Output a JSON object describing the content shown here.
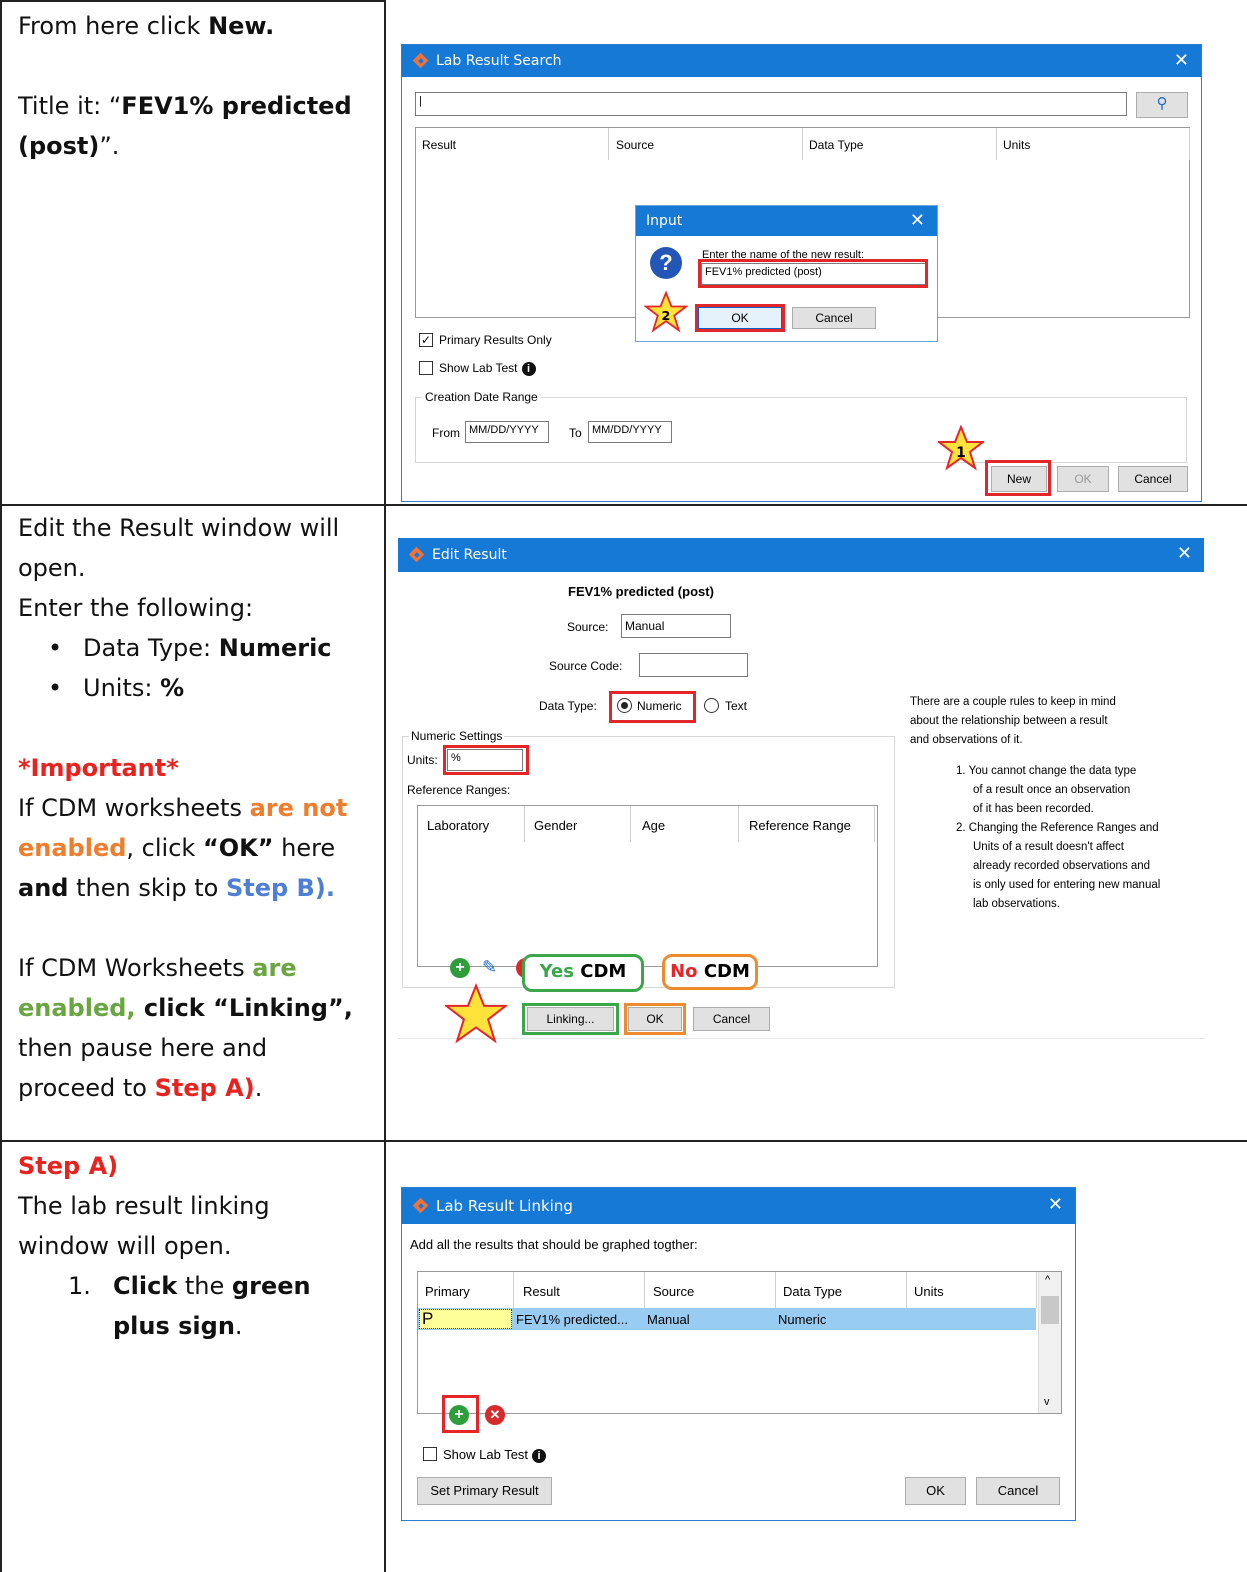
{
  "rows": [
    {
      "left": {
        "line1_prefix": "From here click ",
        "line1_bold": "New.",
        "line2_prefix": "Title it: “",
        "line2_bold_a": "FEV1% predicted",
        "line3_bold": "(post)",
        "line3_suffix": "”."
      },
      "dialog": {
        "title": "Lab Result Search",
        "columns": [
          "Result",
          "Source",
          "Data Type",
          "Units"
        ],
        "primary_only_label": "Primary Results Only",
        "primary_only_checked": true,
        "show_lab_test_label": "Show Lab Test",
        "date_range_label": "Creation Date Range",
        "from_label": "From",
        "to_label": "To",
        "date_placeholder": "MM/DD/YYYY",
        "buttons": {
          "new": "New",
          "ok": "OK",
          "cancel": "Cancel"
        },
        "input_dialog": {
          "title": "Input",
          "prompt": "Enter the name of the new result:",
          "value": "FEV1% predicted (post)",
          "ok": "OK",
          "cancel": "Cancel"
        },
        "star1": "1",
        "star2": "2"
      }
    },
    {
      "left": {
        "line1": "Edit the Result window will",
        "line2": "open.",
        "line3": "Enter the following:",
        "bullet1_prefix": "Data Type: ",
        "bullet1_bold": "Numeric",
        "bullet2_prefix": "Units: ",
        "bullet2_bold": "%",
        "important": "*Important*",
        "p1_a": "If CDM worksheets ",
        "p1_b": "are not",
        "p1_c": "enabled",
        "p1_d": ", click ",
        "p1_e": "“OK”",
        "p1_f": " here",
        "p1_g": "and",
        "p1_h": " then skip to ",
        "p1_i": "Step B",
        "p1_j": ").",
        "p2_a": "If CDM Worksheets ",
        "p2_b": "are",
        "p2_c": "enabled,",
        "p2_d": " click “Linking”,",
        "p2_e": "then pause here and",
        "p2_f": "proceed to ",
        "p2_g": "Step A",
        "p2_h": ")",
        "p2_i": "."
      },
      "dialog": {
        "title": "Edit Result",
        "result_name": "FEV1% predicted (post)",
        "source_label": "Source:",
        "source_value": "Manual",
        "source_code_label": "Source Code:",
        "data_type_label": "Data Type:",
        "numeric_label": "Numeric",
        "text_label": "Text",
        "numeric_settings_label": "Numeric Settings",
        "units_label": "Units:",
        "units_value": "%",
        "ref_ranges_label": "Reference Ranges:",
        "columns": [
          "Laboratory",
          "Gender",
          "Age",
          "Reference Range"
        ],
        "info_intro": [
          "There are a couple rules to keep in mind",
          "about the relationship between a result",
          "and observations of it."
        ],
        "info_rule1": [
          "1. You cannot change the data type",
          "of a result once an observation",
          "of it has been recorded."
        ],
        "info_rule2": [
          "2. Changing the Reference Ranges and",
          "Units of a result doesn't affect",
          "already recorded observations and",
          "is only used for entering new manual",
          "lab observations."
        ],
        "callout_yes_a": "Yes",
        "callout_yes_b": " CDM",
        "callout_no_a": "No",
        "callout_no_b": " CDM",
        "buttons": {
          "linking": "Linking...",
          "ok": "OK",
          "cancel": "Cancel"
        }
      }
    },
    {
      "left": {
        "heading": "Step A)",
        "line1": "The lab result linking",
        "line2": "window will open.",
        "item_num": "1.",
        "item_bold_a": "Click",
        "item_mid": " the ",
        "item_bold_b": "green",
        "item_bold_c": "plus sign",
        "item_suffix": "."
      },
      "dialog": {
        "title": "Lab Result Linking",
        "instruction": "Add all the results that should be graphed togther:",
        "columns": [
          "Primary",
          "Result",
          "Source",
          "Data Type",
          "Units"
        ],
        "row": {
          "primary": "P",
          "result": "FEV1% predicted...",
          "source": "Manual",
          "data_type": "Numeric",
          "units": ""
        },
        "show_lab_test_label": "Show Lab Test",
        "buttons": {
          "set_primary": "Set Primary Result",
          "ok": "OK",
          "cancel": "Cancel"
        }
      }
    }
  ]
}
